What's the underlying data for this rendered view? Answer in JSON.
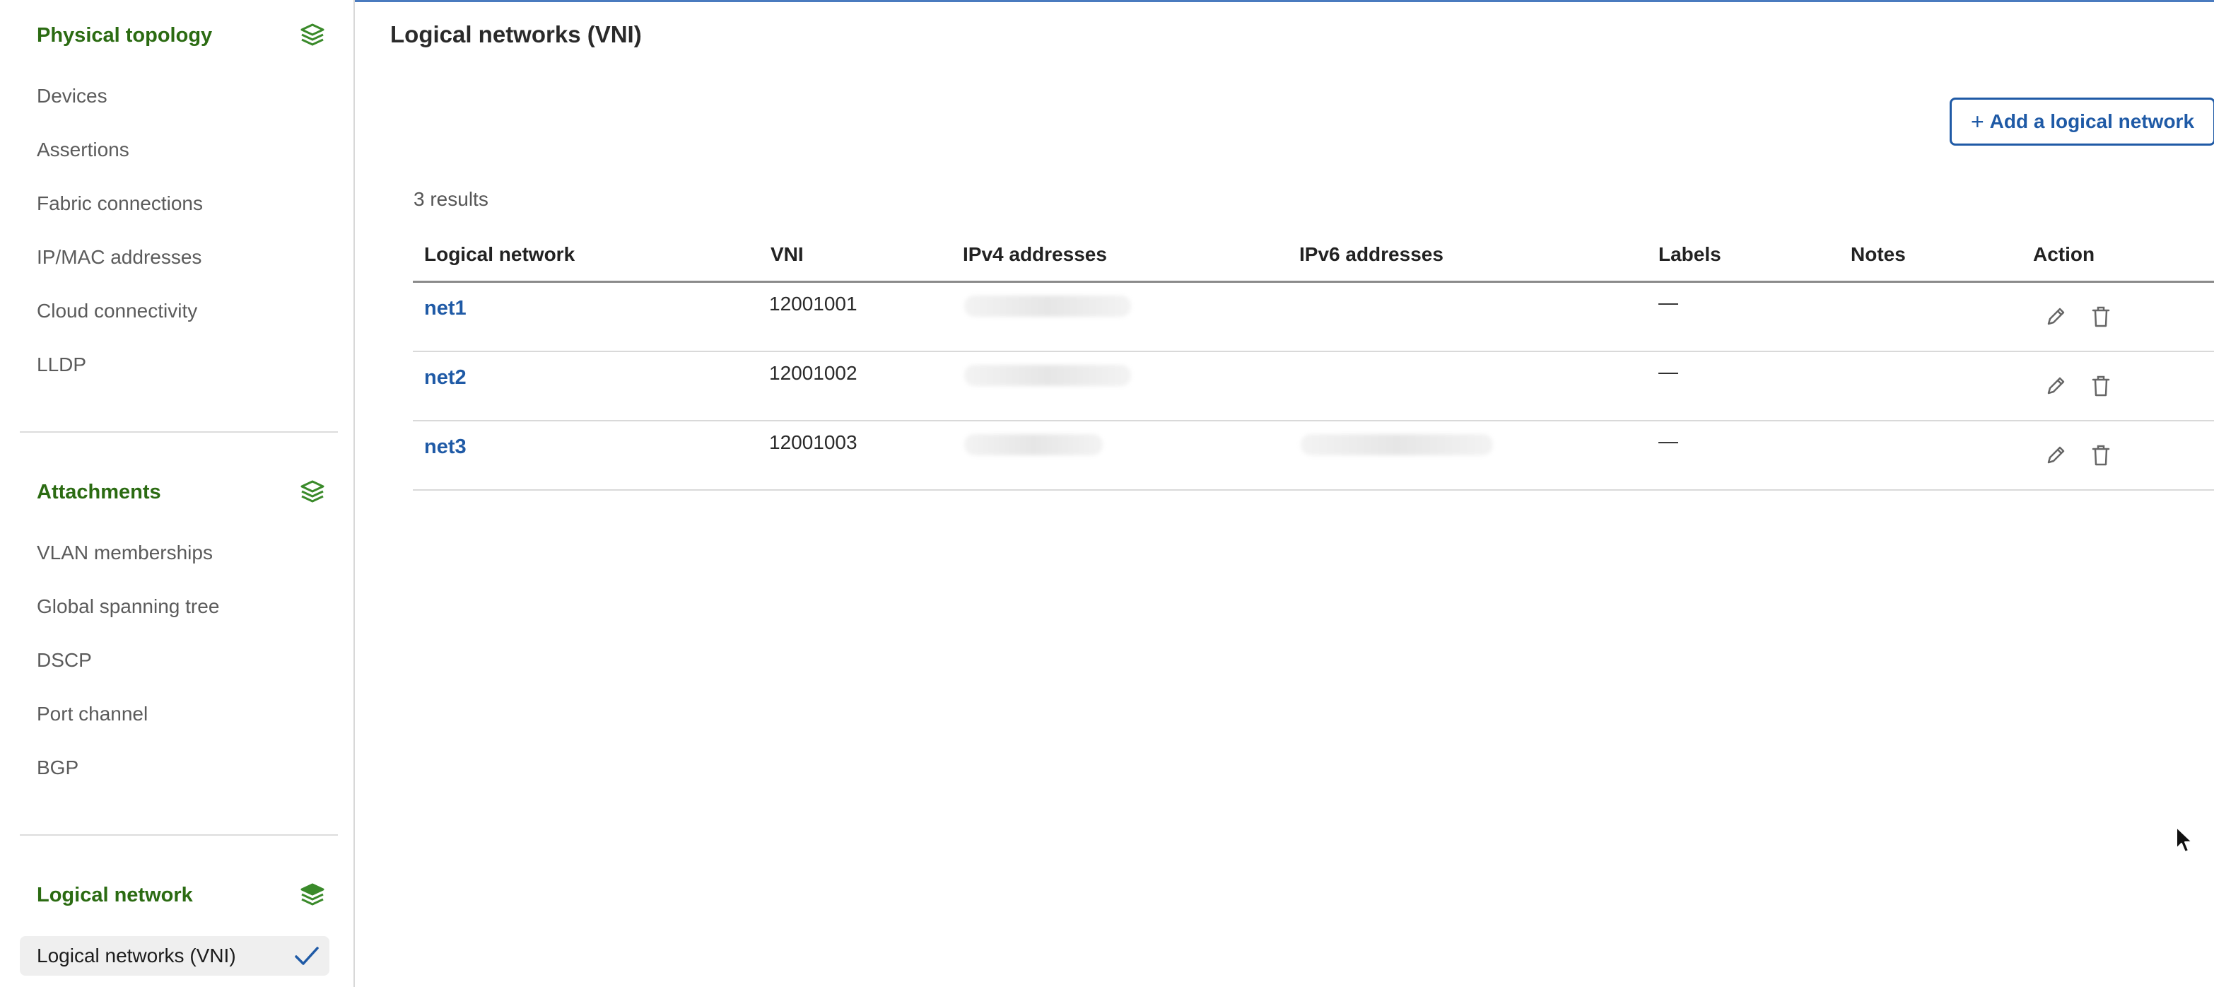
{
  "sidebar": {
    "physical": {
      "title": "Physical topology",
      "icon": "layers-icon",
      "items": [
        "Devices",
        "Assertions",
        "Fabric connections",
        "IP/MAC addresses",
        "Cloud connectivity",
        "LLDP"
      ]
    },
    "attachments": {
      "title": "Attachments",
      "icon": "layers-icon",
      "items": [
        "VLAN memberships",
        "Global spanning tree",
        "DSCP",
        "Port channel",
        "BGP"
      ]
    },
    "logical": {
      "title": "Logical network",
      "icon": "layers-icon",
      "active_item": "Logical networks (VNI)"
    }
  },
  "main": {
    "title": "Logical networks (VNI)",
    "add_button": {
      "icon": "plus",
      "label": "Add a logical network"
    },
    "results": "3 results",
    "columns": [
      "Logical network",
      "VNI",
      "IPv4 addresses",
      "IPv6 addresses",
      "Labels",
      "Notes",
      "Action"
    ],
    "rows": [
      {
        "name": "net1",
        "vni": "12001001",
        "labels": "—",
        "notes": ""
      },
      {
        "name": "net2",
        "vni": "12001002",
        "labels": "—",
        "notes": ""
      },
      {
        "name": "net3",
        "vni": "12001003",
        "labels": "—",
        "notes": ""
      }
    ]
  },
  "colors": {
    "accent_green": "#2b6b12",
    "link_blue": "#1f5aa6",
    "icon_green": "#3a8a2a"
  }
}
